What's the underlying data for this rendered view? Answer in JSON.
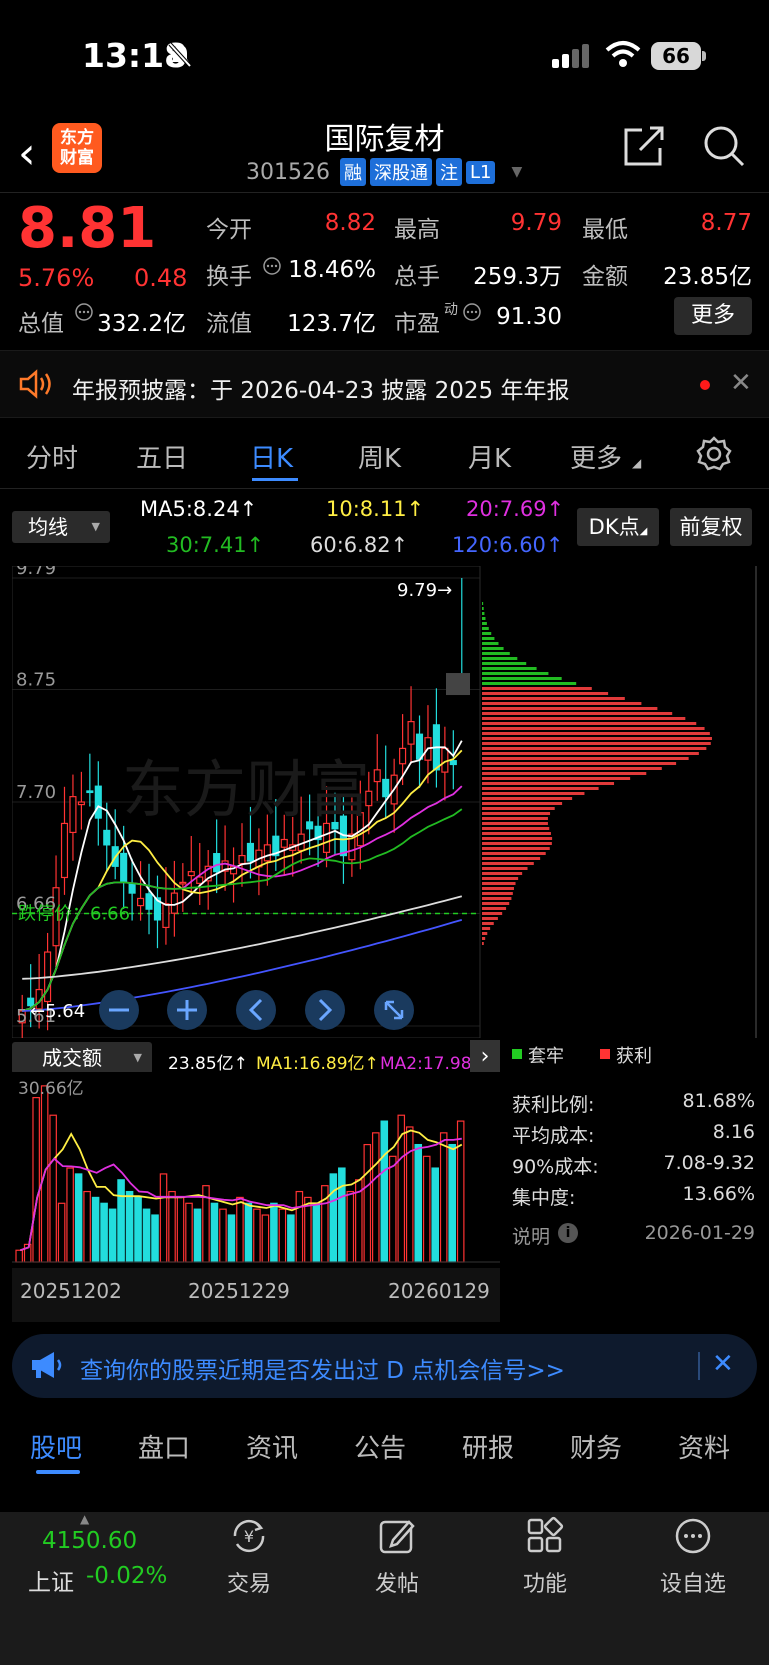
{
  "status_bar": {
    "time": "13:18",
    "battery": "66"
  },
  "header": {
    "title": "国际复材",
    "code": "301526",
    "tags": [
      "融",
      "深股通",
      "注",
      "L1"
    ],
    "logo_text": "东方财富"
  },
  "quote": {
    "price": "8.81",
    "change_pct": "5.76%",
    "change": "0.48",
    "fields": [
      {
        "label": "今开",
        "value": "8.82"
      },
      {
        "label": "最高",
        "value": "9.79"
      },
      {
        "label": "最低",
        "value": "8.77"
      },
      {
        "label": "换手",
        "value": "18.46%"
      },
      {
        "label": "总手",
        "value": "259.3万"
      },
      {
        "label": "金额",
        "value": "23.85亿"
      },
      {
        "label": "总值",
        "value": "332.2亿"
      },
      {
        "label": "流值",
        "value": "123.7亿"
      },
      {
        "label": "市盈",
        "value": "91.30"
      }
    ],
    "pe_superscript": "动",
    "more_label": "更多"
  },
  "notice": {
    "text": "年报预披露：于 2026-04-23 披露 2025 年年报"
  },
  "period_tabs": [
    "分时",
    "五日",
    "日K",
    "周K",
    "月K",
    "更多"
  ],
  "ma_select": "均线",
  "ma_values": {
    "ma5": "MA5:8.24↑",
    "ma10": "10:8.11↑",
    "ma20": "20:7.69↑",
    "ma30": "30:7.41↑",
    "ma60": "60:6.82↑",
    "ma120": "120:6.60↑"
  },
  "dk_label": "DK点",
  "fq_label": "前复权",
  "kline_axis": {
    "y_labels": [
      "9.79",
      "8.75",
      "7.70",
      "6.66",
      "5.61"
    ],
    "max_label": "9.79→",
    "min_label": "←5.64",
    "limit_down_label": "跌停价：6.66",
    "watermark": "东方财富"
  },
  "volume": {
    "select": "成交额",
    "value": "23.85亿↑",
    "ma1": "MA1:16.89亿↑",
    "ma2": "MA2:17.98亿",
    "max_label": "30.66亿",
    "dates": [
      "20251202",
      "20251229",
      "20260129"
    ]
  },
  "chip_panel": {
    "legend": [
      "套牢",
      "获利"
    ],
    "rows": [
      {
        "label": "获利比例:",
        "value": "81.68%"
      },
      {
        "label": "平均成本:",
        "value": "8.16"
      },
      {
        "label": "90%成本:",
        "value": "7.08-9.32"
      },
      {
        "label": "集中度:",
        "value": "13.66%"
      }
    ],
    "note_label": "说明",
    "date": "2026-01-29"
  },
  "banner": {
    "text": "查询你的股票近期是否发出过 D 点机会信号>>"
  },
  "bottom_tabs": [
    "股吧",
    "盘口",
    "资讯",
    "公告",
    "研报",
    "财务",
    "资料"
  ],
  "index": {
    "value": "4150.60",
    "name": "上证",
    "pct": "-0.02%"
  },
  "nav": [
    "交易",
    "发帖",
    "功能",
    "设自选"
  ],
  "colors": {
    "up": "#ff3333",
    "down": "#22dddd",
    "accent": "#3d8bff",
    "ma5": "#ffffff",
    "ma10": "#ffee44",
    "ma20": "#e030e0",
    "ma30": "#22bb22",
    "ma60": "#dddddd",
    "ma120": "#4455ff"
  }
}
